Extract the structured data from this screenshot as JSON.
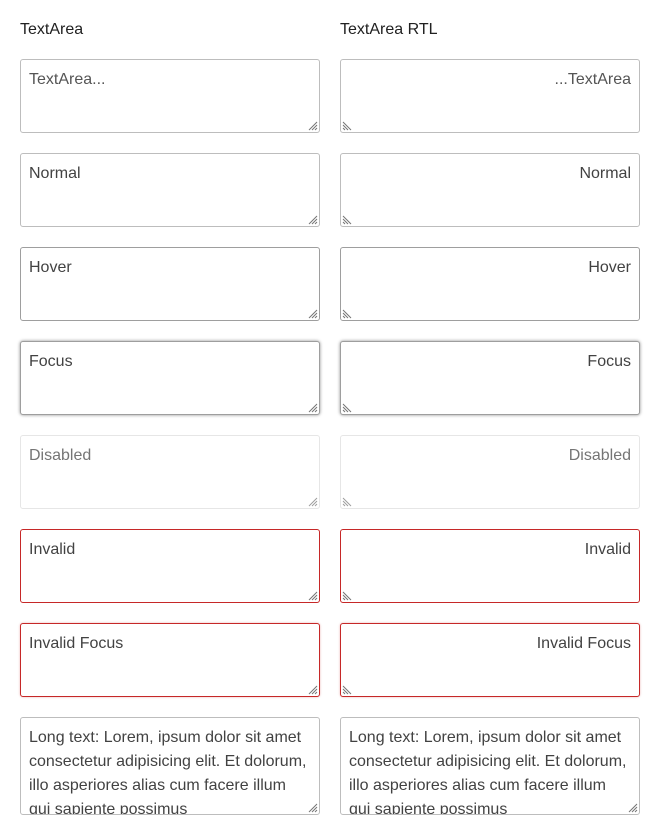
{
  "columns": {
    "ltr": {
      "heading": "TextArea",
      "fields": {
        "placeholder": "TextArea...",
        "normal": "Normal",
        "hover": "Hover",
        "focus": "Focus",
        "disabled": "Disabled",
        "invalid": "Invalid",
        "invalid_focus": "Invalid Focus",
        "long": "Long text: Lorem, ipsum dolor sit amet consectetur adipisicing elit. Et dolorum, illo asperiores alias cum facere illum qui sapiente possimus"
      }
    },
    "rtl": {
      "heading": "TextArea RTL",
      "fields": {
        "placeholder": "TextArea...",
        "normal": "Normal",
        "hover": "Hover",
        "focus": "Focus",
        "disabled": "Disabled",
        "invalid": "Invalid",
        "invalid_focus": "Invalid Focus",
        "long": "Long text: Lorem, ipsum dolor sit amet consectetur adipisicing elit. Et dolorum, illo asperiores alias cum facere illum qui sapiente possimus"
      }
    }
  },
  "colors": {
    "border": "#bdbdbd",
    "border_hover": "#9e9e9e",
    "invalid": "#c62828",
    "text": "#424242"
  },
  "icons": {
    "resize_handle": "resize-grip-icon"
  }
}
